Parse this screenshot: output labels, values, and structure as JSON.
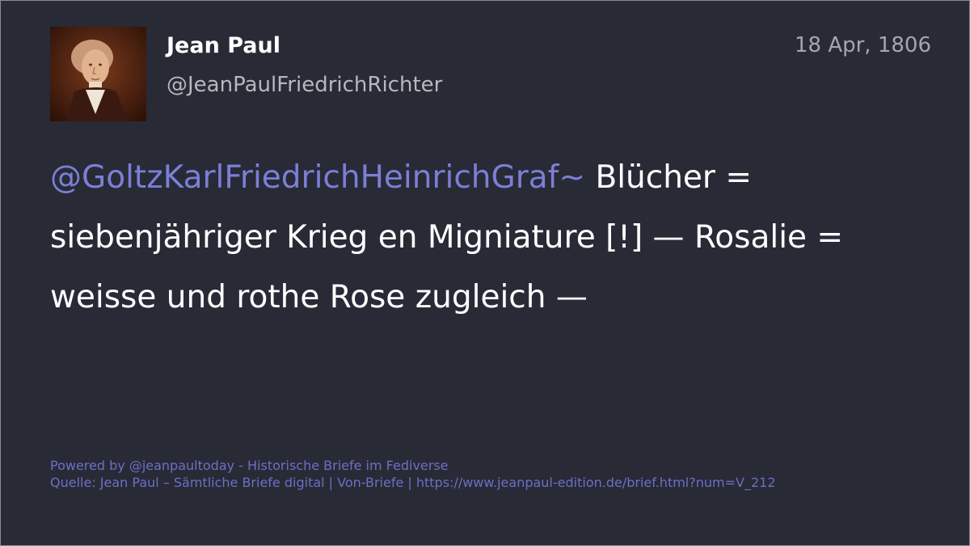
{
  "author": {
    "name": "Jean Paul",
    "handle": "@JeanPaulFriedrichRichter",
    "avatar_icon": "portrait-avatar"
  },
  "post": {
    "date": "18 Apr, 1806",
    "mention": "@GoltzKarlFriedrichHeinrichGraf~",
    "text": " Blücher = siebenjähriger Krieg en Migniature [!] — Rosalie = weisse und rothe Rose zugleich —"
  },
  "footer": {
    "powered_by": "Powered by @jeanpaultoday - Historische Briefe im Fediverse",
    "source": "Quelle: Jean Paul – Sämtliche Briefe digital | Von-Briefe | https://www.jeanpaul-edition.de/brief.html?num=V_212"
  },
  "colors": {
    "background": "#282a36",
    "mention": "#7b7fd6",
    "footer": "#6d6fc4"
  }
}
